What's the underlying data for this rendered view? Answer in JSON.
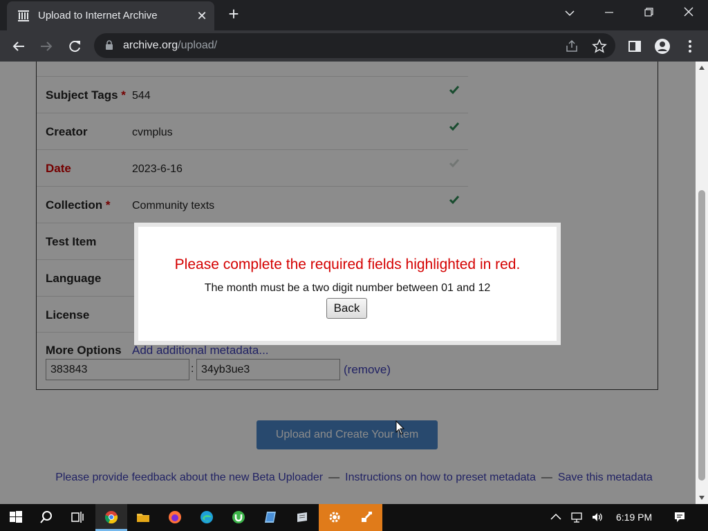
{
  "browser": {
    "tab_title": "Upload to Internet Archive",
    "tab_close": "✕",
    "new_tab": "+",
    "url_host": "archive.org",
    "url_path": "/upload/"
  },
  "form": {
    "rows": [
      {
        "label": "Subject Tags",
        "required": "*",
        "value": "544",
        "status": "ok"
      },
      {
        "label": "Creator",
        "required": "",
        "value": "cvmplus",
        "status": "ok"
      },
      {
        "label": "Date",
        "required": "",
        "value": "2023-6-16",
        "status": "error"
      },
      {
        "label": "Collection",
        "required": "*",
        "value": "Community texts",
        "status": "ok"
      },
      {
        "label": "Test Item",
        "required": "",
        "value": "",
        "status": "none"
      },
      {
        "label": "Language",
        "required": "",
        "value": "",
        "status": "none"
      },
      {
        "label": "License",
        "required": "",
        "value": "",
        "status": "none"
      }
    ],
    "more_options_label": "More Options",
    "add_metadata_link": "Add additional metadata...",
    "extra_key": "383843",
    "extra_separator": ":",
    "extra_value": "34yb3ue3",
    "remove_link": "(remove)",
    "upload_button": "Upload and Create Your Item"
  },
  "footer": {
    "feedback_link": "Please provide feedback about the new Beta Uploader",
    "dash": "—",
    "instructions_link": "Instructions on how to preset metadata",
    "save_link": "Save this metadata"
  },
  "modal": {
    "title": "Please complete the required fields highlighted in red.",
    "message": "The month must be a two digit number between 01 and 12",
    "back_button": "Back"
  },
  "taskbar": {
    "clock": "6:19 PM"
  },
  "colors": {
    "error": "#d40000",
    "link": "#3b3db5",
    "check": "#2e8b57",
    "upload_button": "#4a86c8"
  }
}
